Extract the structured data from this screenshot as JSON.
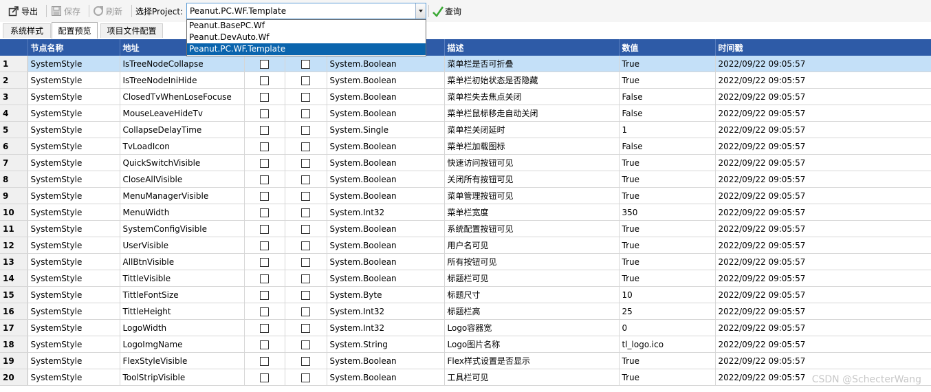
{
  "toolbar": {
    "export_label": "导出",
    "save_label": "保存",
    "refresh_label": "刷新",
    "project_label": "选择Project:",
    "project_value": "Peanut.PC.WF.Template",
    "query_label": "查询",
    "dropdown_options": [
      "Peanut.BasePC.Wf",
      "Peanut.DevAuto.Wf",
      "Peanut.PC.WF.Template"
    ],
    "selected_option_index": 2
  },
  "tabs": [
    "系统样式",
    "配置预览",
    "项目文件配置"
  ],
  "active_tab_index": 1,
  "columns": [
    "节点名称",
    "地址",
    "",
    "",
    "",
    "描述",
    "数值",
    "时间戳"
  ],
  "selected_row_index": 0,
  "rows": [
    {
      "num": "1",
      "node": "SystemStyle",
      "addr": "IsTreeNodeCollapse",
      "type": "System.Boolean",
      "desc": "菜单栏是否可折叠",
      "value": "True",
      "time": "2022/09/22 09:05:57"
    },
    {
      "num": "2",
      "node": "SystemStyle",
      "addr": "IsTreeNodeIniHide",
      "type": "System.Boolean",
      "desc": "菜单栏初始状态是否隐藏",
      "value": "True",
      "time": "2022/09/22 09:05:57"
    },
    {
      "num": "3",
      "node": "SystemStyle",
      "addr": "ClosedTvWhenLoseFocuse",
      "type": "System.Boolean",
      "desc": "菜单栏失去焦点关闭",
      "value": "False",
      "time": "2022/09/22 09:05:57"
    },
    {
      "num": "4",
      "node": "SystemStyle",
      "addr": "MouseLeaveHideTv",
      "type": "System.Boolean",
      "desc": "菜单栏鼠标移走自动关闭",
      "value": "False",
      "time": "2022/09/22 09:05:57"
    },
    {
      "num": "5",
      "node": "SystemStyle",
      "addr": "CollapseDelayTime",
      "type": "System.Single",
      "desc": "菜单栏关闭延时",
      "value": "1",
      "time": "2022/09/22 09:05:57"
    },
    {
      "num": "6",
      "node": "SystemStyle",
      "addr": "TvLoadIcon",
      "type": "System.Boolean",
      "desc": "菜单栏加载图标",
      "value": "False",
      "time": "2022/09/22 09:05:57"
    },
    {
      "num": "7",
      "node": "SystemStyle",
      "addr": "QuickSwitchVisible",
      "type": "System.Boolean",
      "desc": "快速访问按钮可见",
      "value": "True",
      "time": "2022/09/22 09:05:57"
    },
    {
      "num": "8",
      "node": "SystemStyle",
      "addr": "CloseAllVisible",
      "type": "System.Boolean",
      "desc": "关闭所有按钮可见",
      "value": "True",
      "time": "2022/09/22 09:05:57"
    },
    {
      "num": "9",
      "node": "SystemStyle",
      "addr": "MenuManagerVisible",
      "type": "System.Boolean",
      "desc": "菜单管理按钮可见",
      "value": "True",
      "time": "2022/09/22 09:05:57"
    },
    {
      "num": "10",
      "node": "SystemStyle",
      "addr": "MenuWidth",
      "type": "System.Int32",
      "desc": "菜单栏宽度",
      "value": "350",
      "time": "2022/09/22 09:05:57"
    },
    {
      "num": "11",
      "node": "SystemStyle",
      "addr": "SystemConfigVisible",
      "type": "System.Boolean",
      "desc": "系统配置按钮可见",
      "value": "True",
      "time": "2022/09/22 09:05:57"
    },
    {
      "num": "12",
      "node": "SystemStyle",
      "addr": "UserVisible",
      "type": "System.Boolean",
      "desc": "用户名可见",
      "value": "True",
      "time": "2022/09/22 09:05:57"
    },
    {
      "num": "13",
      "node": "SystemStyle",
      "addr": "AllBtnVisible",
      "type": "System.Boolean",
      "desc": "所有按钮可见",
      "value": "True",
      "time": "2022/09/22 09:05:57"
    },
    {
      "num": "14",
      "node": "SystemStyle",
      "addr": "TittleVisible",
      "type": "System.Boolean",
      "desc": "标题栏可见",
      "value": "True",
      "time": "2022/09/22 09:05:57"
    },
    {
      "num": "15",
      "node": "SystemStyle",
      "addr": "TittleFontSize",
      "type": "System.Byte",
      "desc": "标题尺寸",
      "value": "10",
      "time": "2022/09/22 09:05:57"
    },
    {
      "num": "16",
      "node": "SystemStyle",
      "addr": "TittleHeight",
      "type": "System.Int32",
      "desc": "标题栏高",
      "value": "25",
      "time": "2022/09/22 09:05:57"
    },
    {
      "num": "17",
      "node": "SystemStyle",
      "addr": "LogoWidth",
      "type": "System.Int32",
      "desc": "Logo容器宽",
      "value": "0",
      "time": "2022/09/22 09:05:57"
    },
    {
      "num": "18",
      "node": "SystemStyle",
      "addr": "LogoImgName",
      "type": "System.String",
      "desc": "Logo图片名称",
      "value": "tl_logo.ico",
      "time": "2022/09/22 09:05:57"
    },
    {
      "num": "19",
      "node": "SystemStyle",
      "addr": "FlexStyleVisible",
      "type": "System.Boolean",
      "desc": "Flex样式设置是否显示",
      "value": "True",
      "time": "2022/09/22 09:05:57"
    },
    {
      "num": "20",
      "node": "SystemStyle",
      "addr": "ToolStripVisible",
      "type": "System.Boolean",
      "desc": "工具栏可见",
      "value": "True",
      "time": "2022/09/22 09:05:57"
    }
  ],
  "watermark": "CSDN @SchecterWang",
  "colors": {
    "header_bg": "#2e5ba7",
    "selection": "#0a64ad",
    "row_selected": "#c4e0f8"
  }
}
